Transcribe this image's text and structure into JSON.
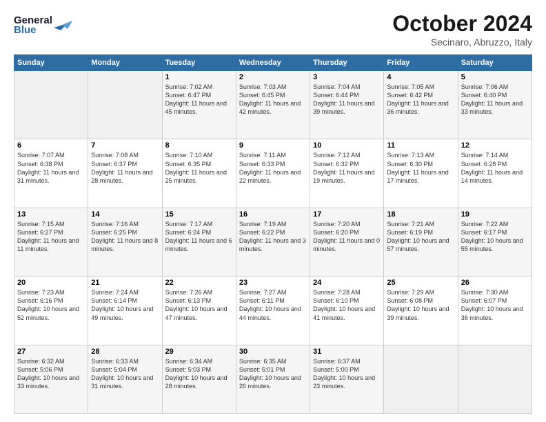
{
  "header": {
    "logo_line1": "General",
    "logo_line2": "Blue",
    "month": "October 2024",
    "location": "Secinaro, Abruzzo, Italy"
  },
  "weekdays": [
    "Sunday",
    "Monday",
    "Tuesday",
    "Wednesday",
    "Thursday",
    "Friday",
    "Saturday"
  ],
  "weeks": [
    [
      {
        "day": "",
        "info": ""
      },
      {
        "day": "",
        "info": ""
      },
      {
        "day": "1",
        "info": "Sunrise: 7:02 AM\nSunset: 6:47 PM\nDaylight: 11 hours\nand 45 minutes."
      },
      {
        "day": "2",
        "info": "Sunrise: 7:03 AM\nSunset: 6:45 PM\nDaylight: 11 hours\nand 42 minutes."
      },
      {
        "day": "3",
        "info": "Sunrise: 7:04 AM\nSunset: 6:44 PM\nDaylight: 11 hours\nand 39 minutes."
      },
      {
        "day": "4",
        "info": "Sunrise: 7:05 AM\nSunset: 6:42 PM\nDaylight: 11 hours\nand 36 minutes."
      },
      {
        "day": "5",
        "info": "Sunrise: 7:06 AM\nSunset: 6:40 PM\nDaylight: 11 hours\nand 33 minutes."
      }
    ],
    [
      {
        "day": "6",
        "info": "Sunrise: 7:07 AM\nSunset: 6:38 PM\nDaylight: 11 hours\nand 31 minutes."
      },
      {
        "day": "7",
        "info": "Sunrise: 7:08 AM\nSunset: 6:37 PM\nDaylight: 11 hours\nand 28 minutes."
      },
      {
        "day": "8",
        "info": "Sunrise: 7:10 AM\nSunset: 6:35 PM\nDaylight: 11 hours\nand 25 minutes."
      },
      {
        "day": "9",
        "info": "Sunrise: 7:11 AM\nSunset: 6:33 PM\nDaylight: 11 hours\nand 22 minutes."
      },
      {
        "day": "10",
        "info": "Sunrise: 7:12 AM\nSunset: 6:32 PM\nDaylight: 11 hours\nand 19 minutes."
      },
      {
        "day": "11",
        "info": "Sunrise: 7:13 AM\nSunset: 6:30 PM\nDaylight: 11 hours\nand 17 minutes."
      },
      {
        "day": "12",
        "info": "Sunrise: 7:14 AM\nSunset: 6:28 PM\nDaylight: 11 hours\nand 14 minutes."
      }
    ],
    [
      {
        "day": "13",
        "info": "Sunrise: 7:15 AM\nSunset: 6:27 PM\nDaylight: 11 hours\nand 11 minutes."
      },
      {
        "day": "14",
        "info": "Sunrise: 7:16 AM\nSunset: 6:25 PM\nDaylight: 11 hours\nand 8 minutes."
      },
      {
        "day": "15",
        "info": "Sunrise: 7:17 AM\nSunset: 6:24 PM\nDaylight: 11 hours\nand 6 minutes."
      },
      {
        "day": "16",
        "info": "Sunrise: 7:19 AM\nSunset: 6:22 PM\nDaylight: 11 hours\nand 3 minutes."
      },
      {
        "day": "17",
        "info": "Sunrise: 7:20 AM\nSunset: 6:20 PM\nDaylight: 11 hours\nand 0 minutes."
      },
      {
        "day": "18",
        "info": "Sunrise: 7:21 AM\nSunset: 6:19 PM\nDaylight: 10 hours\nand 57 minutes."
      },
      {
        "day": "19",
        "info": "Sunrise: 7:22 AM\nSunset: 6:17 PM\nDaylight: 10 hours\nand 55 minutes."
      }
    ],
    [
      {
        "day": "20",
        "info": "Sunrise: 7:23 AM\nSunset: 6:16 PM\nDaylight: 10 hours\nand 52 minutes."
      },
      {
        "day": "21",
        "info": "Sunrise: 7:24 AM\nSunset: 6:14 PM\nDaylight: 10 hours\nand 49 minutes."
      },
      {
        "day": "22",
        "info": "Sunrise: 7:26 AM\nSunset: 6:13 PM\nDaylight: 10 hours\nand 47 minutes."
      },
      {
        "day": "23",
        "info": "Sunrise: 7:27 AM\nSunset: 6:11 PM\nDaylight: 10 hours\nand 44 minutes."
      },
      {
        "day": "24",
        "info": "Sunrise: 7:28 AM\nSunset: 6:10 PM\nDaylight: 10 hours\nand 41 minutes."
      },
      {
        "day": "25",
        "info": "Sunrise: 7:29 AM\nSunset: 6:08 PM\nDaylight: 10 hours\nand 39 minutes."
      },
      {
        "day": "26",
        "info": "Sunrise: 7:30 AM\nSunset: 6:07 PM\nDaylight: 10 hours\nand 36 minutes."
      }
    ],
    [
      {
        "day": "27",
        "info": "Sunrise: 6:32 AM\nSunset: 5:06 PM\nDaylight: 10 hours\nand 33 minutes."
      },
      {
        "day": "28",
        "info": "Sunrise: 6:33 AM\nSunset: 5:04 PM\nDaylight: 10 hours\nand 31 minutes."
      },
      {
        "day": "29",
        "info": "Sunrise: 6:34 AM\nSunset: 5:03 PM\nDaylight: 10 hours\nand 28 minutes."
      },
      {
        "day": "30",
        "info": "Sunrise: 6:35 AM\nSunset: 5:01 PM\nDaylight: 10 hours\nand 26 minutes."
      },
      {
        "day": "31",
        "info": "Sunrise: 6:37 AM\nSunset: 5:00 PM\nDaylight: 10 hours\nand 23 minutes."
      },
      {
        "day": "",
        "info": ""
      },
      {
        "day": "",
        "info": ""
      }
    ]
  ]
}
